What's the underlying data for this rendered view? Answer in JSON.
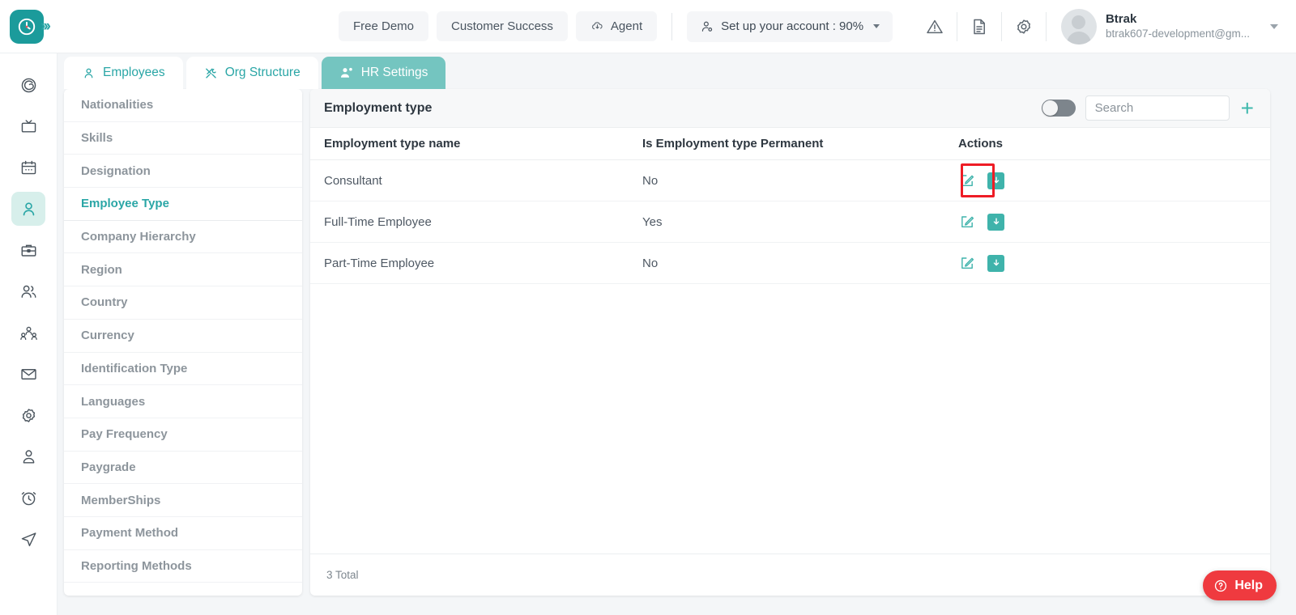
{
  "brand": {
    "logo_icon": "clock-logo-icon",
    "expand_icon": "chevrons-right-icon",
    "accent": "#2aa6a6",
    "teal": "#3fb3ab"
  },
  "topbar": {
    "nav_buttons": [
      {
        "label": "Free Demo",
        "icon": ""
      },
      {
        "label": "Customer Success",
        "icon": ""
      },
      {
        "label": "Agent",
        "icon": "cloud-download-icon"
      }
    ],
    "account_setup": {
      "label": "Set up your account : 90%",
      "icon": "user-cog-icon",
      "caret": "chevron-down-icon"
    },
    "icons": [
      "warning-triangle-icon",
      "document-icon",
      "gear-icon"
    ],
    "user": {
      "name": "Btrak",
      "email": "btrak607-development@gm...",
      "avatar": "avatar-placeholder",
      "caret": "chevron-down-icon"
    }
  },
  "rail": {
    "items": [
      {
        "name": "dashboard",
        "icon": "spiral-target-icon",
        "active": false
      },
      {
        "name": "tv",
        "icon": "tv-icon",
        "active": false
      },
      {
        "name": "calendar",
        "icon": "calendar-icon",
        "active": false
      },
      {
        "name": "employees",
        "icon": "person-icon",
        "active": true
      },
      {
        "name": "briefcase",
        "icon": "briefcase-icon",
        "active": false
      },
      {
        "name": "teams",
        "icon": "people-icon",
        "active": false
      },
      {
        "name": "org",
        "icon": "org-people-icon",
        "active": false
      },
      {
        "name": "mail",
        "icon": "envelope-icon",
        "active": false
      },
      {
        "name": "settings",
        "icon": "gear-icon",
        "active": false
      },
      {
        "name": "profile",
        "icon": "user-badge-icon",
        "active": false
      },
      {
        "name": "timer",
        "icon": "alarm-clock-icon",
        "active": false
      },
      {
        "name": "send",
        "icon": "paper-plane-icon",
        "active": false
      }
    ]
  },
  "tabs": [
    {
      "label": "Employees",
      "icon": "person-icon",
      "active": false
    },
    {
      "label": "Org Structure",
      "icon": "tools-icon",
      "active": false
    },
    {
      "label": "HR Settings",
      "icon": "people-gear-icon",
      "active": true
    }
  ],
  "settings_list": {
    "items": [
      {
        "label": "Nationalities",
        "active": false
      },
      {
        "label": "Skills",
        "active": false
      },
      {
        "label": "Designation",
        "active": false
      },
      {
        "label": "Employee Type",
        "active": true
      },
      {
        "label": "Company Hierarchy",
        "active": false
      },
      {
        "label": "Region",
        "active": false
      },
      {
        "label": "Country",
        "active": false
      },
      {
        "label": "Currency",
        "active": false
      },
      {
        "label": "Identification Type",
        "active": false
      },
      {
        "label": "Languages",
        "active": false
      },
      {
        "label": "Pay Frequency",
        "active": false
      },
      {
        "label": "Paygrade",
        "active": false
      },
      {
        "label": "MemberShips",
        "active": false
      },
      {
        "label": "Payment Method",
        "active": false
      },
      {
        "label": "Reporting Methods",
        "active": false
      }
    ]
  },
  "panel": {
    "title": "Employment type",
    "toggle_on": false,
    "search": {
      "value": "",
      "placeholder": "Search"
    },
    "add_icon": "plus-icon",
    "columns": [
      "Employment type name",
      "Is Employment type Permanent",
      "Actions"
    ],
    "rows": [
      {
        "name": "Consultant",
        "permanent": "No",
        "edit_icon": "edit-pencil-icon",
        "download_icon": "download-box-icon",
        "highlighted": true
      },
      {
        "name": "Full-Time Employee",
        "permanent": "Yes",
        "edit_icon": "edit-pencil-icon",
        "download_icon": "download-box-icon",
        "highlighted": false
      },
      {
        "name": "Part-Time Employee",
        "permanent": "No",
        "edit_icon": "edit-pencil-icon",
        "download_icon": "download-box-icon",
        "highlighted": false
      }
    ],
    "footer_total": "3 Total"
  },
  "help": {
    "label": "Help",
    "icon": "question-circle-icon",
    "color": "#ef3a3f"
  }
}
